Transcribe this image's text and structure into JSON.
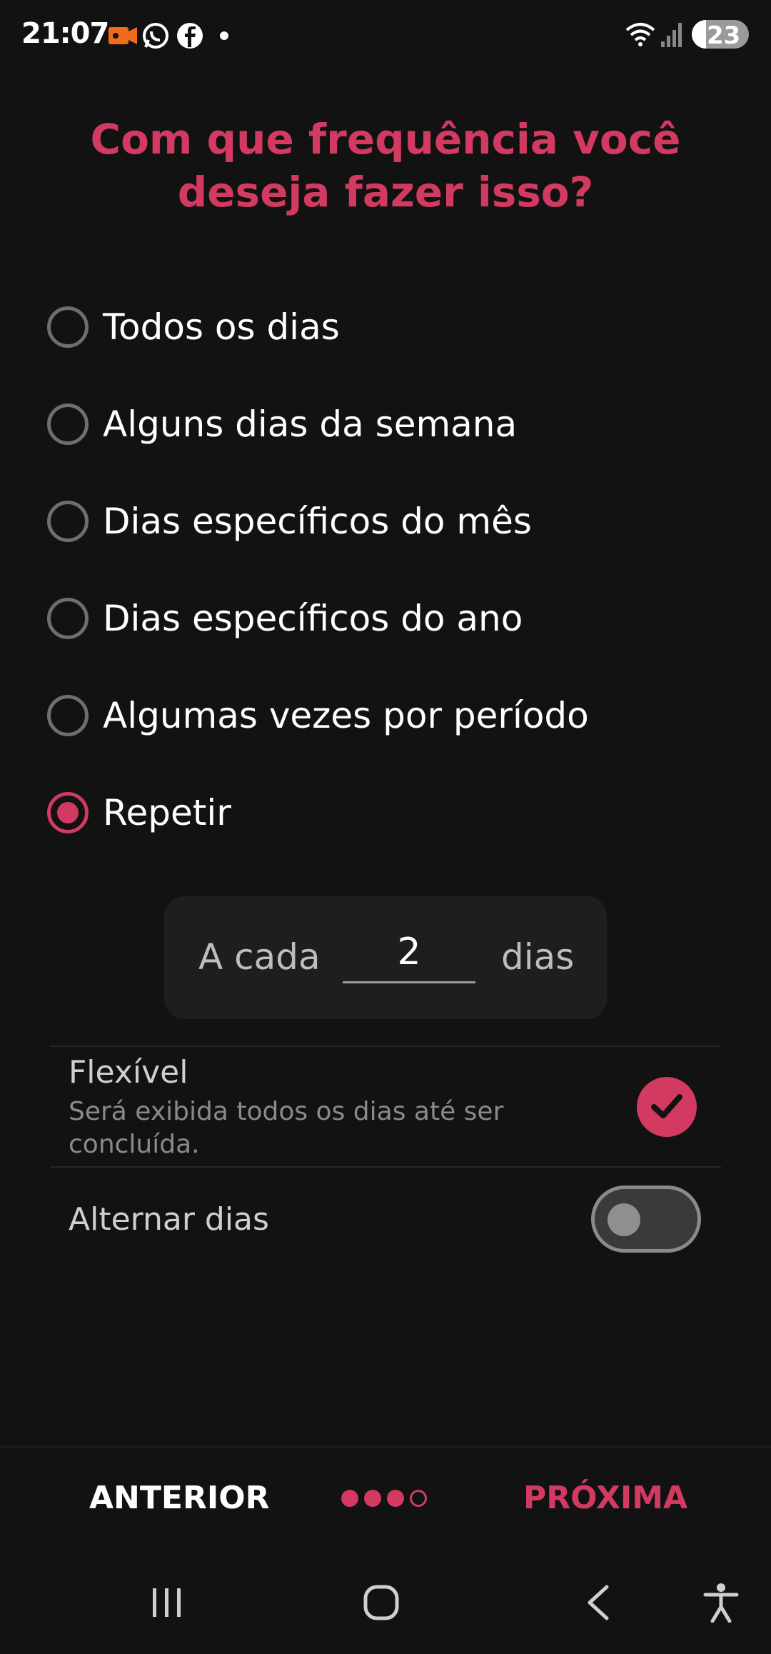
{
  "status_bar": {
    "time": "21:07",
    "battery": "23",
    "icons": [
      "video-recording-icon",
      "whatsapp-icon",
      "facebook-icon",
      "dot-icon",
      "wifi-icon",
      "signal-icon",
      "battery-icon"
    ]
  },
  "page": {
    "title": "Com que frequência você deseja fazer isso?",
    "options": [
      {
        "label": "Todos os dias",
        "selected": false
      },
      {
        "label": "Alguns dias da semana",
        "selected": false
      },
      {
        "label": "Dias específicos do mês",
        "selected": false
      },
      {
        "label": "Dias específicos do ano",
        "selected": false
      },
      {
        "label": "Algumas vezes por período",
        "selected": false
      },
      {
        "label": "Repetir",
        "selected": true
      }
    ],
    "interval": {
      "prefix": "A cada",
      "value": "2",
      "suffix": "dias"
    },
    "flexible": {
      "title": "Flexível",
      "description": "Será exibida todos os dias até ser concluída.",
      "checked": true
    },
    "alternate_days": {
      "label": "Alternar dias",
      "enabled": false
    }
  },
  "footer": {
    "previous_label": "ANTERIOR",
    "next_label": "PRÓXIMA",
    "step_current": 3,
    "step_total": 4
  },
  "colors": {
    "accent": "#d23a61",
    "background": "#121212"
  }
}
